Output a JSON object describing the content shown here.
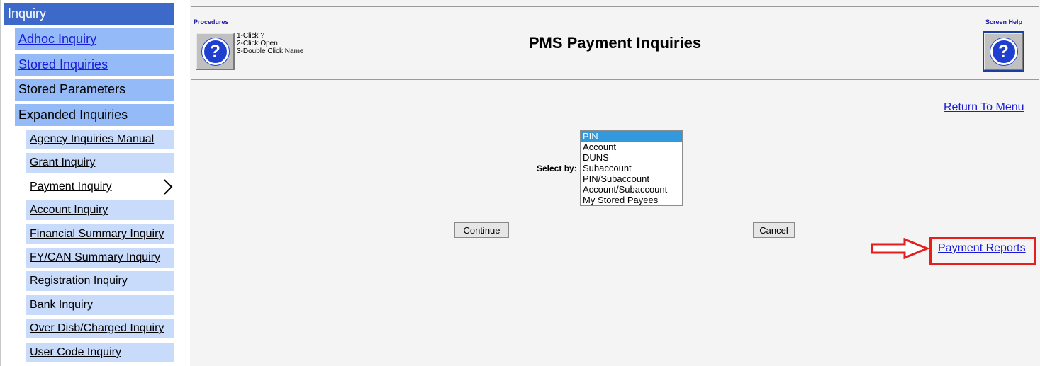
{
  "sidebar": {
    "header": "Inquiry",
    "level1": [
      {
        "label": "Adhoc Inquiry",
        "link": true
      },
      {
        "label": "Stored Inquiries",
        "link": true
      },
      {
        "label": "Stored Parameters",
        "link": false
      },
      {
        "label": "Expanded Inquiries",
        "link": false
      }
    ],
    "level2": [
      {
        "label": "Agency Inquiries Manual"
      },
      {
        "label": "Grant Inquiry"
      },
      {
        "label": "Payment Inquiry",
        "active": true
      },
      {
        "label": "Account Inquiry"
      },
      {
        "label": "Financial Summary Inquiry"
      },
      {
        "label": "FY/CAN Summary Inquiry"
      },
      {
        "label": "Registration Inquiry"
      },
      {
        "label": "Bank Inquiry"
      },
      {
        "label": "Over Disb/Charged Inquiry"
      },
      {
        "label": "User Code Inquiry"
      }
    ],
    "active_icon": "chevron-right-icon"
  },
  "header": {
    "procedures_label": "Procedures",
    "screen_help_label": "Screen Help",
    "steps": [
      "1-Click ?",
      "2-Click Open",
      "3-Double Click Name"
    ],
    "title": "PMS Payment Inquiries",
    "help_icon": "question-mark-icon"
  },
  "main": {
    "return_link": "Return To Menu",
    "select_label": "Select by:",
    "options": [
      "PIN",
      "Account",
      "DUNS",
      "Subaccount",
      "PIN/Subaccount",
      "Account/Subaccount",
      "My Stored Payees"
    ],
    "selected_index": 0,
    "continue_label": "Continue",
    "cancel_label": "Cancel",
    "reports_link": "Payment Reports"
  },
  "colors": {
    "sidebar_header": "#3d6ac9",
    "sidebar_level1": "#94bbf7",
    "sidebar_level2": "#c9dbfa",
    "link": "#1a1ad8",
    "highlight": "#e51e1e",
    "selected_option": "#3399dd"
  }
}
